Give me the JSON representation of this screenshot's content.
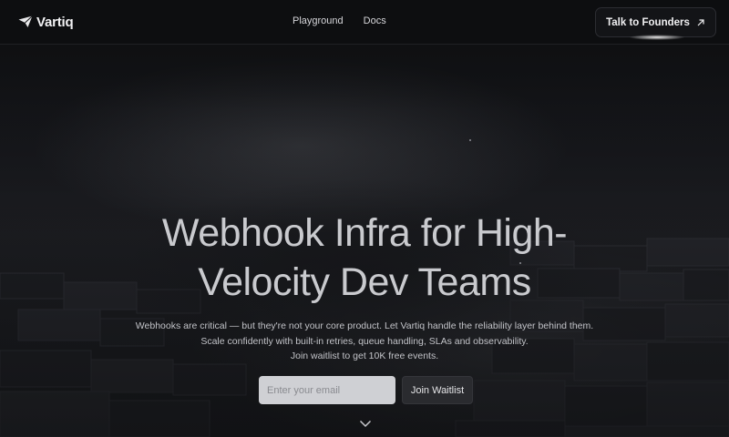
{
  "brand": {
    "name": "Vartiq",
    "logo_icon": "paper-plane-icon"
  },
  "nav": {
    "links": [
      {
        "label": "Playground"
      },
      {
        "label": "Docs"
      }
    ],
    "cta_label": "Talk to Founders",
    "cta_icon": "arrow-up-right-icon"
  },
  "hero": {
    "headline_line1": "Webhook Infra for High-",
    "headline_line2": "Velocity Dev Teams",
    "sub_line1": "Webhooks are critical — but they're not your core product. Let Vartiq handle the reliability layer behind them.",
    "sub_line2": "Scale confidently with built-in retries, queue handling, SLAs and observability.",
    "sub_line3": "Join waitlist to get 10K free events.",
    "email_placeholder": "Enter your email",
    "join_label": "Join Waitlist",
    "scroll_icon": "chevron-down-icon"
  },
  "colors": {
    "background": "#0d0e10",
    "input_bg": "#cfd0d4",
    "button_bg": "#2a2b2f"
  }
}
